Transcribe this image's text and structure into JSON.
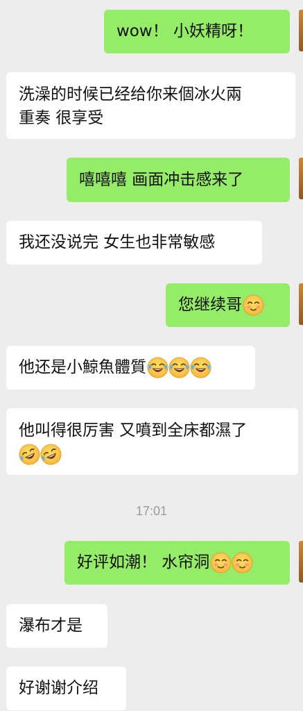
{
  "messages": [
    {
      "id": "m1",
      "side": "sent",
      "text": "wow！ 小妖精呀！"
    },
    {
      "id": "m2",
      "side": "received",
      "line1": "洗澡的时候已经给你来個冰火兩",
      "line2": "重奏 很享受"
    },
    {
      "id": "m3",
      "side": "sent",
      "text": "嘻嘻嘻 画面冲击感来了"
    },
    {
      "id": "m4",
      "side": "received",
      "text": "我还没说完 女生也非常敏感"
    },
    {
      "id": "m5",
      "side": "sent",
      "text": "您继续哥",
      "emojis": [
        "blush-emoji"
      ]
    },
    {
      "id": "m6",
      "side": "received",
      "text": "他还是小鯨魚體質",
      "emojis": [
        "tears-of-joy-emoji",
        "tears-of-joy-emoji",
        "tears-of-joy-emoji"
      ]
    },
    {
      "id": "m7",
      "side": "received",
      "line1": "他叫得很厉害 又噴到全床都濕了",
      "emojis": [
        "rolling-laughing-emoji",
        "rolling-laughing-emoji"
      ]
    },
    {
      "id": "m8",
      "side": "sent",
      "text": "好评如潮！ 水帘洞",
      "emojis": [
        "blush-emoji",
        "blush-emoji"
      ]
    },
    {
      "id": "m9",
      "side": "received",
      "text": "瀑布才是"
    },
    {
      "id": "m10",
      "side": "received",
      "text": "好谢谢介绍"
    }
  ],
  "timestamp": "17:01",
  "colors": {
    "background": "#ededed",
    "sent_bubble": "#95ec69",
    "received_bubble": "#ffffff",
    "timestamp_text": "#9b9b9b"
  }
}
